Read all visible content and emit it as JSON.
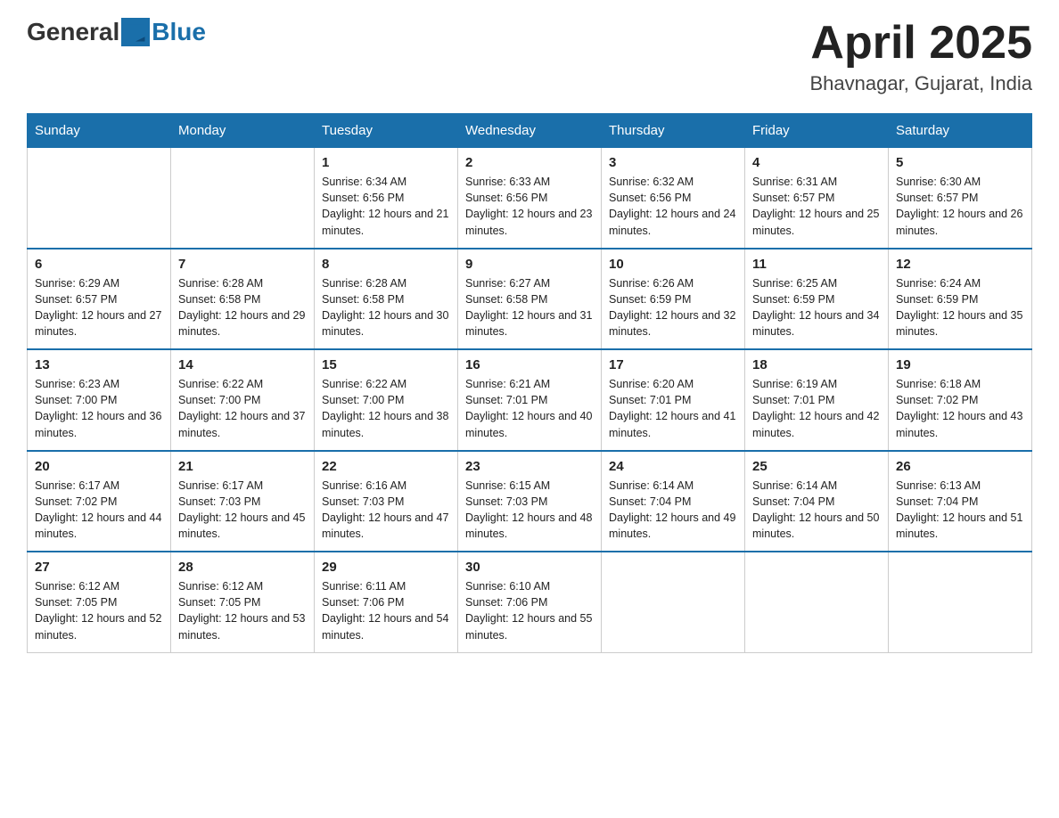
{
  "logo": {
    "general": "General",
    "blue": "Blue"
  },
  "title": "April 2025",
  "subtitle": "Bhavnagar, Gujarat, India",
  "weekdays": [
    "Sunday",
    "Monday",
    "Tuesday",
    "Wednesday",
    "Thursday",
    "Friday",
    "Saturday"
  ],
  "weeks": [
    [
      {
        "day": "",
        "sunrise": "",
        "sunset": "",
        "daylight": ""
      },
      {
        "day": "",
        "sunrise": "",
        "sunset": "",
        "daylight": ""
      },
      {
        "day": "1",
        "sunrise": "Sunrise: 6:34 AM",
        "sunset": "Sunset: 6:56 PM",
        "daylight": "Daylight: 12 hours and 21 minutes."
      },
      {
        "day": "2",
        "sunrise": "Sunrise: 6:33 AM",
        "sunset": "Sunset: 6:56 PM",
        "daylight": "Daylight: 12 hours and 23 minutes."
      },
      {
        "day": "3",
        "sunrise": "Sunrise: 6:32 AM",
        "sunset": "Sunset: 6:56 PM",
        "daylight": "Daylight: 12 hours and 24 minutes."
      },
      {
        "day": "4",
        "sunrise": "Sunrise: 6:31 AM",
        "sunset": "Sunset: 6:57 PM",
        "daylight": "Daylight: 12 hours and 25 minutes."
      },
      {
        "day": "5",
        "sunrise": "Sunrise: 6:30 AM",
        "sunset": "Sunset: 6:57 PM",
        "daylight": "Daylight: 12 hours and 26 minutes."
      }
    ],
    [
      {
        "day": "6",
        "sunrise": "Sunrise: 6:29 AM",
        "sunset": "Sunset: 6:57 PM",
        "daylight": "Daylight: 12 hours and 27 minutes."
      },
      {
        "day": "7",
        "sunrise": "Sunrise: 6:28 AM",
        "sunset": "Sunset: 6:58 PM",
        "daylight": "Daylight: 12 hours and 29 minutes."
      },
      {
        "day": "8",
        "sunrise": "Sunrise: 6:28 AM",
        "sunset": "Sunset: 6:58 PM",
        "daylight": "Daylight: 12 hours and 30 minutes."
      },
      {
        "day": "9",
        "sunrise": "Sunrise: 6:27 AM",
        "sunset": "Sunset: 6:58 PM",
        "daylight": "Daylight: 12 hours and 31 minutes."
      },
      {
        "day": "10",
        "sunrise": "Sunrise: 6:26 AM",
        "sunset": "Sunset: 6:59 PM",
        "daylight": "Daylight: 12 hours and 32 minutes."
      },
      {
        "day": "11",
        "sunrise": "Sunrise: 6:25 AM",
        "sunset": "Sunset: 6:59 PM",
        "daylight": "Daylight: 12 hours and 34 minutes."
      },
      {
        "day": "12",
        "sunrise": "Sunrise: 6:24 AM",
        "sunset": "Sunset: 6:59 PM",
        "daylight": "Daylight: 12 hours and 35 minutes."
      }
    ],
    [
      {
        "day": "13",
        "sunrise": "Sunrise: 6:23 AM",
        "sunset": "Sunset: 7:00 PM",
        "daylight": "Daylight: 12 hours and 36 minutes."
      },
      {
        "day": "14",
        "sunrise": "Sunrise: 6:22 AM",
        "sunset": "Sunset: 7:00 PM",
        "daylight": "Daylight: 12 hours and 37 minutes."
      },
      {
        "day": "15",
        "sunrise": "Sunrise: 6:22 AM",
        "sunset": "Sunset: 7:00 PM",
        "daylight": "Daylight: 12 hours and 38 minutes."
      },
      {
        "day": "16",
        "sunrise": "Sunrise: 6:21 AM",
        "sunset": "Sunset: 7:01 PM",
        "daylight": "Daylight: 12 hours and 40 minutes."
      },
      {
        "day": "17",
        "sunrise": "Sunrise: 6:20 AM",
        "sunset": "Sunset: 7:01 PM",
        "daylight": "Daylight: 12 hours and 41 minutes."
      },
      {
        "day": "18",
        "sunrise": "Sunrise: 6:19 AM",
        "sunset": "Sunset: 7:01 PM",
        "daylight": "Daylight: 12 hours and 42 minutes."
      },
      {
        "day": "19",
        "sunrise": "Sunrise: 6:18 AM",
        "sunset": "Sunset: 7:02 PM",
        "daylight": "Daylight: 12 hours and 43 minutes."
      }
    ],
    [
      {
        "day": "20",
        "sunrise": "Sunrise: 6:17 AM",
        "sunset": "Sunset: 7:02 PM",
        "daylight": "Daylight: 12 hours and 44 minutes."
      },
      {
        "day": "21",
        "sunrise": "Sunrise: 6:17 AM",
        "sunset": "Sunset: 7:03 PM",
        "daylight": "Daylight: 12 hours and 45 minutes."
      },
      {
        "day": "22",
        "sunrise": "Sunrise: 6:16 AM",
        "sunset": "Sunset: 7:03 PM",
        "daylight": "Daylight: 12 hours and 47 minutes."
      },
      {
        "day": "23",
        "sunrise": "Sunrise: 6:15 AM",
        "sunset": "Sunset: 7:03 PM",
        "daylight": "Daylight: 12 hours and 48 minutes."
      },
      {
        "day": "24",
        "sunrise": "Sunrise: 6:14 AM",
        "sunset": "Sunset: 7:04 PM",
        "daylight": "Daylight: 12 hours and 49 minutes."
      },
      {
        "day": "25",
        "sunrise": "Sunrise: 6:14 AM",
        "sunset": "Sunset: 7:04 PM",
        "daylight": "Daylight: 12 hours and 50 minutes."
      },
      {
        "day": "26",
        "sunrise": "Sunrise: 6:13 AM",
        "sunset": "Sunset: 7:04 PM",
        "daylight": "Daylight: 12 hours and 51 minutes."
      }
    ],
    [
      {
        "day": "27",
        "sunrise": "Sunrise: 6:12 AM",
        "sunset": "Sunset: 7:05 PM",
        "daylight": "Daylight: 12 hours and 52 minutes."
      },
      {
        "day": "28",
        "sunrise": "Sunrise: 6:12 AM",
        "sunset": "Sunset: 7:05 PM",
        "daylight": "Daylight: 12 hours and 53 minutes."
      },
      {
        "day": "29",
        "sunrise": "Sunrise: 6:11 AM",
        "sunset": "Sunset: 7:06 PM",
        "daylight": "Daylight: 12 hours and 54 minutes."
      },
      {
        "day": "30",
        "sunrise": "Sunrise: 6:10 AM",
        "sunset": "Sunset: 7:06 PM",
        "daylight": "Daylight: 12 hours and 55 minutes."
      },
      {
        "day": "",
        "sunrise": "",
        "sunset": "",
        "daylight": ""
      },
      {
        "day": "",
        "sunrise": "",
        "sunset": "",
        "daylight": ""
      },
      {
        "day": "",
        "sunrise": "",
        "sunset": "",
        "daylight": ""
      }
    ]
  ]
}
